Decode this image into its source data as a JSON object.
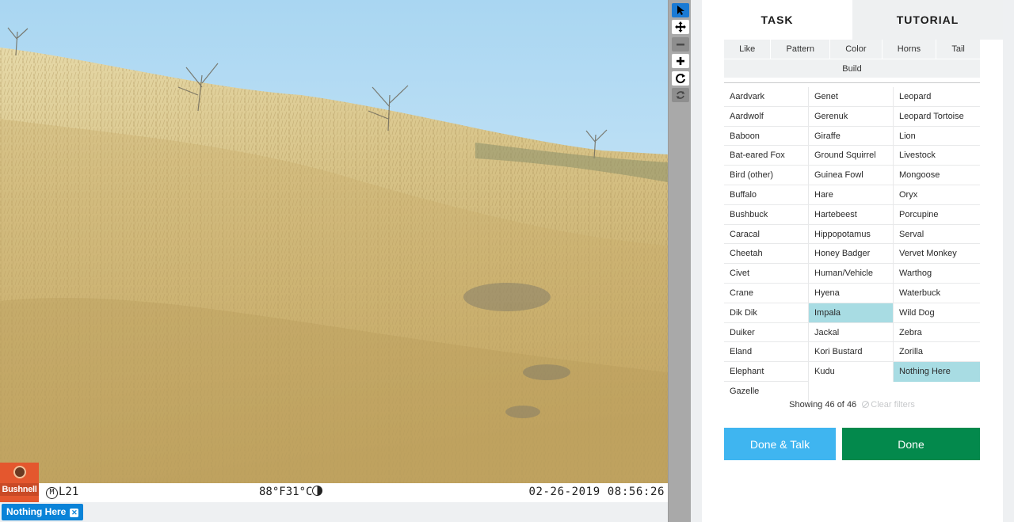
{
  "camera": {
    "brand": "Bushnell",
    "camera_id": "L21",
    "camera_id_prefix": "M",
    "temperature": "88°F31°C",
    "timestamp": "02-26-2019 08:56:26"
  },
  "selected_tag": {
    "label": "Nothing Here"
  },
  "toolbar": {
    "tools": [
      {
        "name": "select-tool",
        "icon": "pointer-icon",
        "state": "active"
      },
      {
        "name": "pan-tool",
        "icon": "move-icon",
        "state": "normal"
      },
      {
        "name": "zoom-out-tool",
        "icon": "minus-icon",
        "state": "disabled"
      },
      {
        "name": "zoom-in-tool",
        "icon": "plus-icon",
        "state": "normal"
      },
      {
        "name": "rotate-tool",
        "icon": "rotate-icon",
        "state": "normal"
      },
      {
        "name": "reset-tool",
        "icon": "reset-icon",
        "state": "disabled"
      }
    ]
  },
  "tabs": {
    "task": "TASK",
    "tutorial": "TUTORIAL"
  },
  "filters": {
    "row1": [
      "Like",
      "Pattern",
      "Color",
      "Horns",
      "Tail"
    ],
    "row2": "Build"
  },
  "choices": {
    "columns": [
      [
        "Aardvark",
        "Aardwolf",
        "Baboon",
        "Bat-eared Fox",
        "Bird (other)",
        "Buffalo",
        "Bushbuck",
        "Caracal",
        "Cheetah",
        "Civet",
        "Crane",
        "Dik Dik",
        "Duiker",
        "Eland",
        "Elephant",
        "Gazelle"
      ],
      [
        "Genet",
        "Gerenuk",
        "Giraffe",
        "Ground Squirrel",
        "Guinea Fowl",
        "Hare",
        "Hartebeest",
        "Hippopotamus",
        "Honey Badger",
        "Human/Vehicle",
        "Hyena",
        "Impala",
        "Jackal",
        "Kori Bustard",
        "Kudu"
      ],
      [
        "Leopard",
        "Leopard Tortoise",
        "Lion",
        "Livestock",
        "Mongoose",
        "Oryx",
        "Porcupine",
        "Serval",
        "Vervet Monkey",
        "Warthog",
        "Waterbuck",
        "Wild Dog",
        "Zebra",
        "Zorilla",
        "Nothing Here"
      ]
    ],
    "selected": [
      "Impala",
      "Nothing Here"
    ]
  },
  "status": {
    "showing_prefix": "Showing",
    "showing_count": "46",
    "showing_of": "of",
    "showing_total": "46",
    "clear_filters": "Clear filters"
  },
  "buttons": {
    "done_talk": "Done & Talk",
    "done": "Done"
  },
  "colors": {
    "selected_choice": "#a8dce3",
    "done_talk": "#3fb5f0",
    "done": "#03894c",
    "tag": "#0a83d8",
    "active_tool": "#1a7ad4"
  }
}
